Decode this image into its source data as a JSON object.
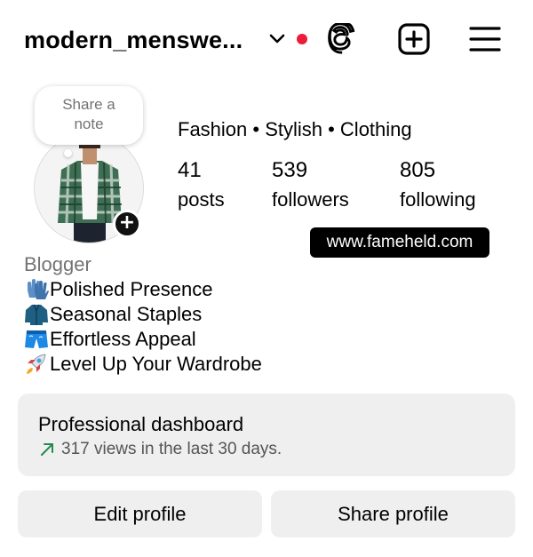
{
  "header": {
    "username": "modern_menswe...",
    "threads_icon": "threads-icon",
    "create_icon": "plus-square-icon",
    "menu_icon": "hamburger-menu-icon",
    "notification_color": "#ed1c3a"
  },
  "note": {
    "line1": "Share a",
    "line2": "note"
  },
  "profile": {
    "category": "Fashion • Stylish • Clothing",
    "stats": [
      {
        "value": "41",
        "label": "posts"
      },
      {
        "value": "539",
        "label": "followers"
      },
      {
        "value": "805",
        "label": "following"
      }
    ],
    "link": "www.fameheld.com"
  },
  "bio": {
    "title": "Blogger",
    "lines": [
      {
        "icon": "gloves-emoji",
        "text": "Polished Presence"
      },
      {
        "icon": "coat-emoji",
        "text": "Seasonal Staples"
      },
      {
        "icon": "shorts-emoji",
        "text": "Effortless Appeal"
      },
      {
        "icon": "rocket-emoji",
        "text": "Level Up Your Wardrobe"
      }
    ]
  },
  "dashboard": {
    "title": "Professional dashboard",
    "subtitle": "317 views in the last 30 days.",
    "trend_color": "#1e8c4e"
  },
  "actions": {
    "edit_label": "Edit profile",
    "share_label": "Share profile"
  }
}
